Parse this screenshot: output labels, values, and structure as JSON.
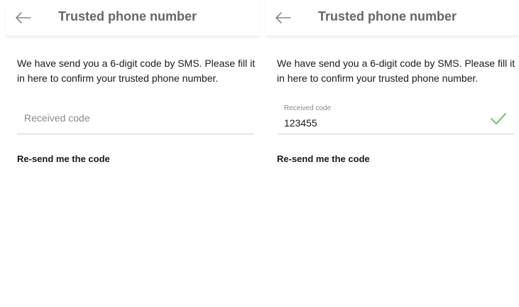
{
  "screens": [
    {
      "header": {
        "back_icon": "arrow-left-icon",
        "title": "Trusted phone number"
      },
      "intro": "We have send you a 6-digit code by SMS. Please fill it in here to confirm your trusted phone number.",
      "code_field": {
        "placeholder": "Received code",
        "value": ""
      },
      "resend_label": "Re-send me the code"
    },
    {
      "header": {
        "back_icon": "arrow-left-icon",
        "title": "Trusted phone number"
      },
      "intro": "We have send you a 6-digit code by SMS. Please fill it in here to confirm your trusted phone number.",
      "code_field": {
        "label": "Received code",
        "value": "123455",
        "valid_icon": "checkmark-icon"
      },
      "resend_label": "Re-send me the code"
    }
  ],
  "colors": {
    "accent_valid": "#5cbf5c",
    "title_gray": "#666666",
    "divider": "#cfcfcf"
  }
}
